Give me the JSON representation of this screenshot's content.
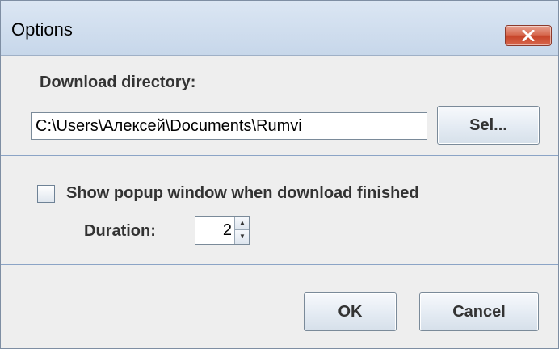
{
  "window": {
    "title": "Options",
    "close_icon": "close-icon"
  },
  "download": {
    "label": "Download directory:",
    "path": "C:\\Users\\Алексей\\Documents\\Rumvi",
    "select_button": "Sel..."
  },
  "popup": {
    "checkbox_label": "Show popup window when download finished",
    "checked": false,
    "duration_label": "Duration:",
    "duration_value": "2"
  },
  "buttons": {
    "ok": "OK",
    "cancel": "Cancel"
  },
  "colors": {
    "separator": "#8ba4c6",
    "close_button": "#d76a50",
    "background": "#eeeeee"
  }
}
